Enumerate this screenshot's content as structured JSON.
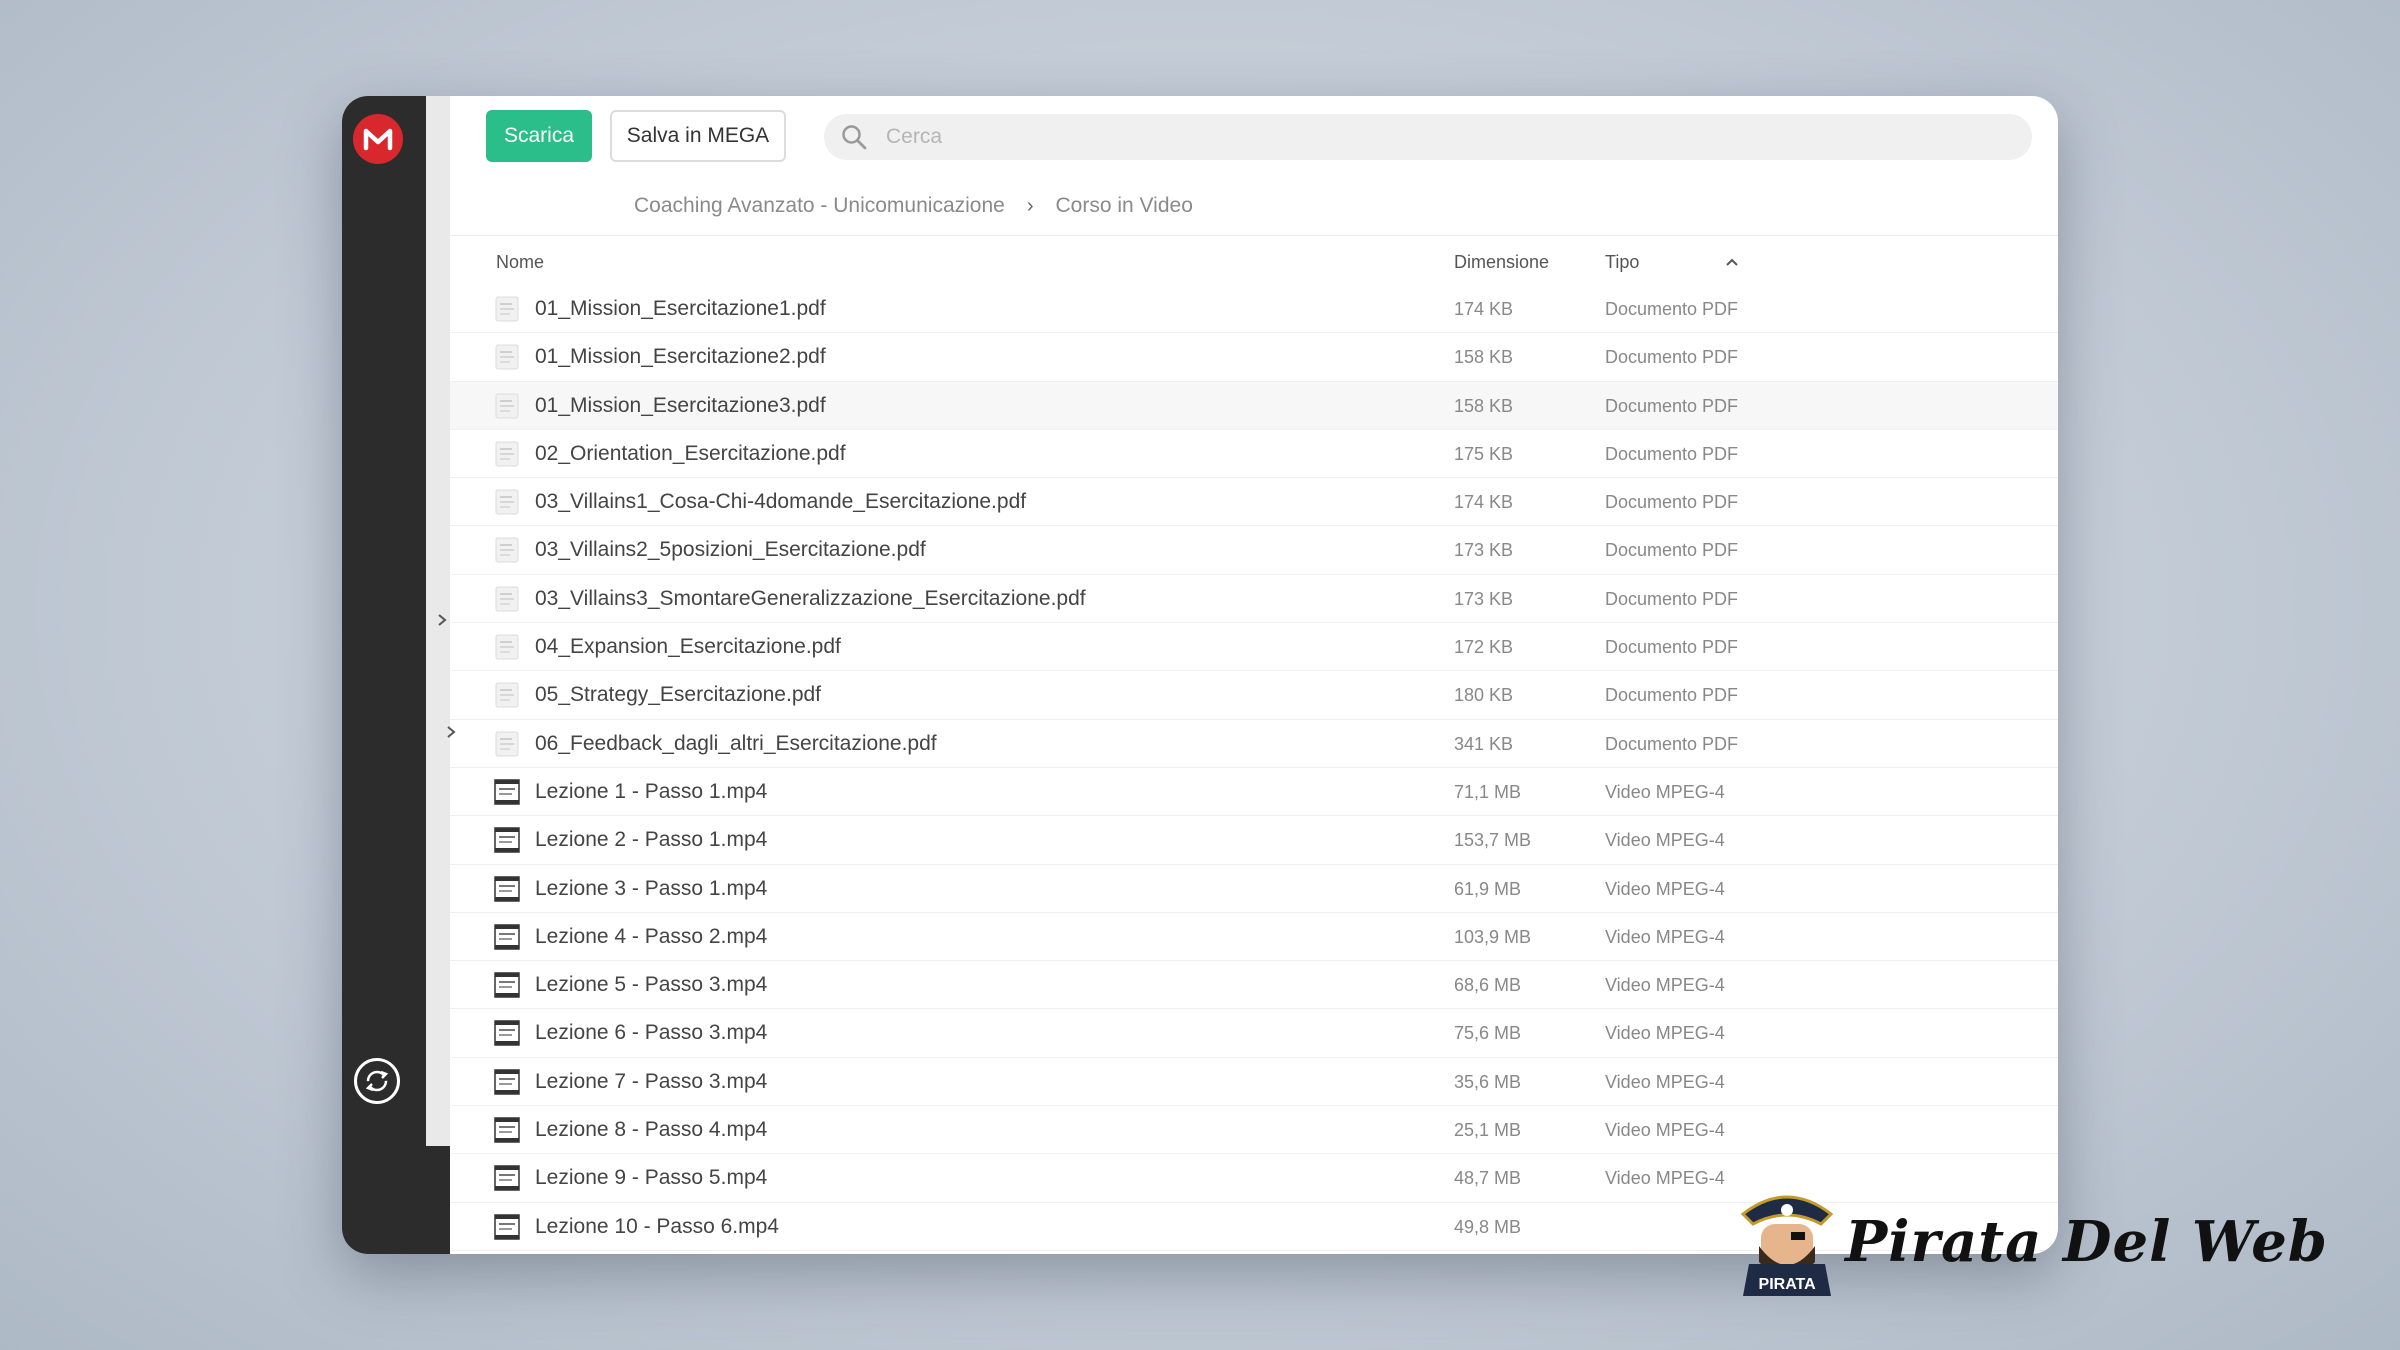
{
  "toolbar": {
    "download_label": "Scarica",
    "save_label": "Salva in MEGA"
  },
  "search": {
    "placeholder": "Cerca",
    "value": ""
  },
  "breadcrumb": {
    "items": [
      "Coaching Avanzato - Unicomunicazione",
      "Corso in Video"
    ],
    "separator": "›"
  },
  "columns": {
    "name": "Nome",
    "size": "Dimensione",
    "type": "Tipo"
  },
  "files": [
    {
      "name": "01_Mission_Esercitazione1.pdf",
      "size": "174 KB",
      "type": "Documento PDF",
      "kind": "pdf"
    },
    {
      "name": "01_Mission_Esercitazione2.pdf",
      "size": "158 KB",
      "type": "Documento PDF",
      "kind": "pdf"
    },
    {
      "name": "01_Mission_Esercitazione3.pdf",
      "size": "158 KB",
      "type": "Documento PDF",
      "kind": "pdf"
    },
    {
      "name": "02_Orientation_Esercitazione.pdf",
      "size": "175 KB",
      "type": "Documento PDF",
      "kind": "pdf"
    },
    {
      "name": "03_Villains1_Cosa-Chi-4domande_Esercitazione.pdf",
      "size": "174 KB",
      "type": "Documento PDF",
      "kind": "pdf"
    },
    {
      "name": "03_Villains2_5posizioni_Esercitazione.pdf",
      "size": "173 KB",
      "type": "Documento PDF",
      "kind": "pdf"
    },
    {
      "name": "03_Villains3_SmontareGeneralizzazione_Esercitazione.pdf",
      "size": "173 KB",
      "type": "Documento PDF",
      "kind": "pdf"
    },
    {
      "name": "04_Expansion_Esercitazione.pdf",
      "size": "172 KB",
      "type": "Documento PDF",
      "kind": "pdf"
    },
    {
      "name": "05_Strategy_Esercitazione.pdf",
      "size": "180 KB",
      "type": "Documento PDF",
      "kind": "pdf"
    },
    {
      "name": "06_Feedback_dagli_altri_Esercitazione.pdf",
      "size": "341 KB",
      "type": "Documento PDF",
      "kind": "pdf"
    },
    {
      "name": "Lezione 1 - Passo 1.mp4",
      "size": "71,1 MB",
      "type": "Video MPEG-4",
      "kind": "video"
    },
    {
      "name": "Lezione 2 - Passo 1.mp4",
      "size": "153,7 MB",
      "type": "Video MPEG-4",
      "kind": "video"
    },
    {
      "name": "Lezione 3 - Passo 1.mp4",
      "size": "61,9 MB",
      "type": "Video MPEG-4",
      "kind": "video"
    },
    {
      "name": "Lezione 4 - Passo 2.mp4",
      "size": "103,9 MB",
      "type": "Video MPEG-4",
      "kind": "video"
    },
    {
      "name": "Lezione 5 - Passo 3.mp4",
      "size": "68,6 MB",
      "type": "Video MPEG-4",
      "kind": "video"
    },
    {
      "name": "Lezione 6 - Passo 3.mp4",
      "size": "75,6 MB",
      "type": "Video MPEG-4",
      "kind": "video"
    },
    {
      "name": "Lezione 7 - Passo 3.mp4",
      "size": "35,6 MB",
      "type": "Video MPEG-4",
      "kind": "video"
    },
    {
      "name": "Lezione 8 - Passo 4.mp4",
      "size": "25,1 MB",
      "type": "Video MPEG-4",
      "kind": "video"
    },
    {
      "name": "Lezione 9 - Passo 5.mp4",
      "size": "48,7 MB",
      "type": "Video MPEG-4",
      "kind": "video"
    },
    {
      "name": "Lezione 10 - Passo 6.mp4",
      "size": "49,8 MB",
      "type": "",
      "kind": "video"
    }
  ],
  "highlighted_row": 2,
  "watermark": {
    "text": "Pirata Del Web",
    "badge_text": "PIRATA"
  },
  "colors": {
    "accent": "#2bbd8a",
    "mega_red": "#d9272e",
    "sidebar": "#2c2c2c"
  },
  "icons": {
    "logo": "mega-logo-icon",
    "search": "search-icon",
    "sync": "sync-icon",
    "sort": "chevron-up-icon",
    "expand": "chevron-right-icon",
    "pdf": "pdf-file-icon",
    "video": "video-file-icon"
  }
}
